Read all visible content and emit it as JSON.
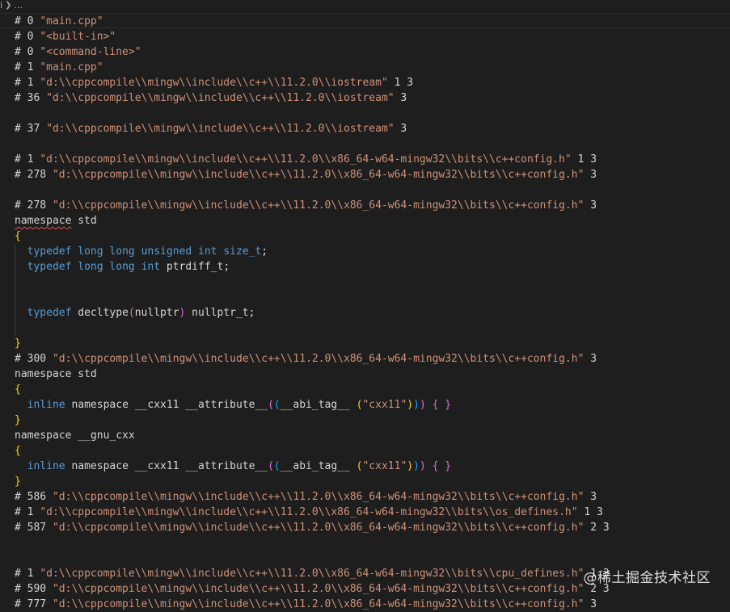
{
  "breadcrumb": {
    "file": "i",
    "ellipsis": "..."
  },
  "lines": [
    [
      {
        "t": "# 0 "
      },
      {
        "t": "\"main.cpp\"",
        "c": "str"
      }
    ],
    [
      {
        "t": "# 0 "
      },
      {
        "t": "\"<built-in>\"",
        "c": "str"
      }
    ],
    [
      {
        "t": "# 0 "
      },
      {
        "t": "\"<command-line>\"",
        "c": "str"
      }
    ],
    [
      {
        "t": "# 1 "
      },
      {
        "t": "\"main.cpp\"",
        "c": "str"
      }
    ],
    [
      {
        "t": "# 1 "
      },
      {
        "t": "\"d:\\\\cppcompile\\\\mingw\\\\include\\\\c++\\\\11.2.0\\\\iostream\"",
        "c": "str"
      },
      {
        "t": " 1 3"
      }
    ],
    [
      {
        "t": "# 36 "
      },
      {
        "t": "\"d:\\\\cppcompile\\\\mingw\\\\include\\\\c++\\\\11.2.0\\\\iostream\"",
        "c": "str"
      },
      {
        "t": " 3"
      }
    ],
    [],
    [
      {
        "t": "# 37 "
      },
      {
        "t": "\"d:\\\\cppcompile\\\\mingw\\\\include\\\\c++\\\\11.2.0\\\\iostream\"",
        "c": "str"
      },
      {
        "t": " 3"
      }
    ],
    [],
    [
      {
        "t": "# 1 "
      },
      {
        "t": "\"d:\\\\cppcompile\\\\mingw\\\\include\\\\c++\\\\11.2.0\\\\x86_64-w64-mingw32\\\\bits\\\\c++config.h\"",
        "c": "str"
      },
      {
        "t": " 1 3"
      }
    ],
    [
      {
        "t": "# 278 "
      },
      {
        "t": "\"d:\\\\cppcompile\\\\mingw\\\\include\\\\c++\\\\11.2.0\\\\x86_64-w64-mingw32\\\\bits\\\\c++config.h\"",
        "c": "str"
      },
      {
        "t": " 3"
      }
    ],
    [],
    [
      {
        "t": "# 278 "
      },
      {
        "t": "\"d:\\\\cppcompile\\\\mingw\\\\include\\\\c++\\\\11.2.0\\\\x86_64-w64-mingw32\\\\bits\\\\c++config.h\"",
        "c": "str"
      },
      {
        "t": " 3"
      }
    ],
    [
      {
        "t": "namespace",
        "c": "ns-squiggle"
      },
      {
        "t": " std"
      }
    ],
    [
      {
        "t": "{",
        "c": "br1"
      }
    ],
    [
      {
        "t": "  "
      },
      {
        "t": "typedef",
        "c": "kw"
      },
      {
        "t": " "
      },
      {
        "t": "long",
        "c": "kw"
      },
      {
        "t": " "
      },
      {
        "t": "long",
        "c": "kw"
      },
      {
        "t": " "
      },
      {
        "t": "unsigned",
        "c": "kw"
      },
      {
        "t": " "
      },
      {
        "t": "int",
        "c": "kw"
      },
      {
        "t": " "
      },
      {
        "t": "size_t",
        "c": "kw"
      },
      {
        "t": ";"
      }
    ],
    [
      {
        "t": "  "
      },
      {
        "t": "typedef",
        "c": "kw"
      },
      {
        "t": " "
      },
      {
        "t": "long",
        "c": "kw"
      },
      {
        "t": " "
      },
      {
        "t": "long",
        "c": "kw"
      },
      {
        "t": " "
      },
      {
        "t": "int",
        "c": "kw"
      },
      {
        "t": " ptrdiff_t;"
      }
    ],
    [
      {
        "t": "  "
      }
    ],
    [
      {
        "t": "  "
      }
    ],
    [
      {
        "t": "  "
      },
      {
        "t": "typedef",
        "c": "kw"
      },
      {
        "t": " decltype"
      },
      {
        "t": "(",
        "c": "br2"
      },
      {
        "t": "nullptr"
      },
      {
        "t": ")",
        "c": "br2"
      },
      {
        "t": " nullptr_t;"
      }
    ],
    [
      {
        "t": "  "
      }
    ],
    [
      {
        "t": "}",
        "c": "br1"
      }
    ],
    [
      {
        "t": "# 300 "
      },
      {
        "t": "\"d:\\\\cppcompile\\\\mingw\\\\include\\\\c++\\\\11.2.0\\\\x86_64-w64-mingw32\\\\bits\\\\c++config.h\"",
        "c": "str"
      },
      {
        "t": " 3"
      }
    ],
    [
      {
        "t": "namespace std"
      }
    ],
    [
      {
        "t": "{",
        "c": "br1"
      }
    ],
    [
      {
        "t": "  "
      },
      {
        "t": "inline",
        "c": "kw"
      },
      {
        "t": " namespace __cxx11 __attribute__"
      },
      {
        "t": "(",
        "c": "br2"
      },
      {
        "t": "(",
        "c": "br3"
      },
      {
        "t": "__abi_tag__ "
      },
      {
        "t": "(",
        "c": "br1"
      },
      {
        "t": "\"cxx11\"",
        "c": "str"
      },
      {
        "t": ")",
        "c": "br1"
      },
      {
        "t": ")",
        "c": "br3"
      },
      {
        "t": ")",
        "c": "br2"
      },
      {
        "t": " "
      },
      {
        "t": "{ }",
        "c": "br2"
      }
    ],
    [
      {
        "t": "}",
        "c": "br1"
      }
    ],
    [
      {
        "t": "namespace __gnu_cxx"
      }
    ],
    [
      {
        "t": "{",
        "c": "br1"
      }
    ],
    [
      {
        "t": "  "
      },
      {
        "t": "inline",
        "c": "kw"
      },
      {
        "t": " namespace __cxx11 __attribute__"
      },
      {
        "t": "(",
        "c": "br2"
      },
      {
        "t": "(",
        "c": "br3"
      },
      {
        "t": "__abi_tag__ "
      },
      {
        "t": "(",
        "c": "br1"
      },
      {
        "t": "\"cxx11\"",
        "c": "str"
      },
      {
        "t": ")",
        "c": "br1"
      },
      {
        "t": ")",
        "c": "br3"
      },
      {
        "t": ")",
        "c": "br2"
      },
      {
        "t": " "
      },
      {
        "t": "{ }",
        "c": "br2"
      }
    ],
    [
      {
        "t": "}",
        "c": "br1"
      }
    ],
    [
      {
        "t": "# 586 "
      },
      {
        "t": "\"d:\\\\cppcompile\\\\mingw\\\\include\\\\c++\\\\11.2.0\\\\x86_64-w64-mingw32\\\\bits\\\\c++config.h\"",
        "c": "str"
      },
      {
        "t": " 3"
      }
    ],
    [
      {
        "t": "# 1 "
      },
      {
        "t": "\"d:\\\\cppcompile\\\\mingw\\\\include\\\\c++\\\\11.2.0\\\\x86_64-w64-mingw32\\\\bits\\\\os_defines.h\"",
        "c": "str"
      },
      {
        "t": " 1 3"
      }
    ],
    [
      {
        "t": "# 587 "
      },
      {
        "t": "\"d:\\\\cppcompile\\\\mingw\\\\include\\\\c++\\\\11.2.0\\\\x86_64-w64-mingw32\\\\bits\\\\c++config.h\"",
        "c": "str"
      },
      {
        "t": " 2 3"
      }
    ],
    [],
    [],
    [
      {
        "t": "# 1 "
      },
      {
        "t": "\"d:\\\\cppcompile\\\\mingw\\\\include\\\\c++\\\\11.2.0\\\\x86_64-w64-mingw32\\\\bits\\\\cpu_defines.h\"",
        "c": "str"
      },
      {
        "t": " 1 3"
      }
    ],
    [
      {
        "t": "# 590 "
      },
      {
        "t": "\"d:\\\\cppcompile\\\\mingw\\\\include\\\\c++\\\\11.2.0\\\\x86_64-w64-mingw32\\\\bits\\\\c++config.h\"",
        "c": "str"
      },
      {
        "t": " 2 3"
      }
    ],
    [
      {
        "t": "# 777 "
      },
      {
        "t": "\"d:\\\\cppcompile\\\\mingw\\\\include\\\\c++\\\\11.2.0\\\\x86_64-w64-mingw32\\\\bits\\\\c++config.h\"",
        "c": "str"
      },
      {
        "t": " 3"
      }
    ]
  ],
  "watermark": "@稀土掘金技术社区"
}
